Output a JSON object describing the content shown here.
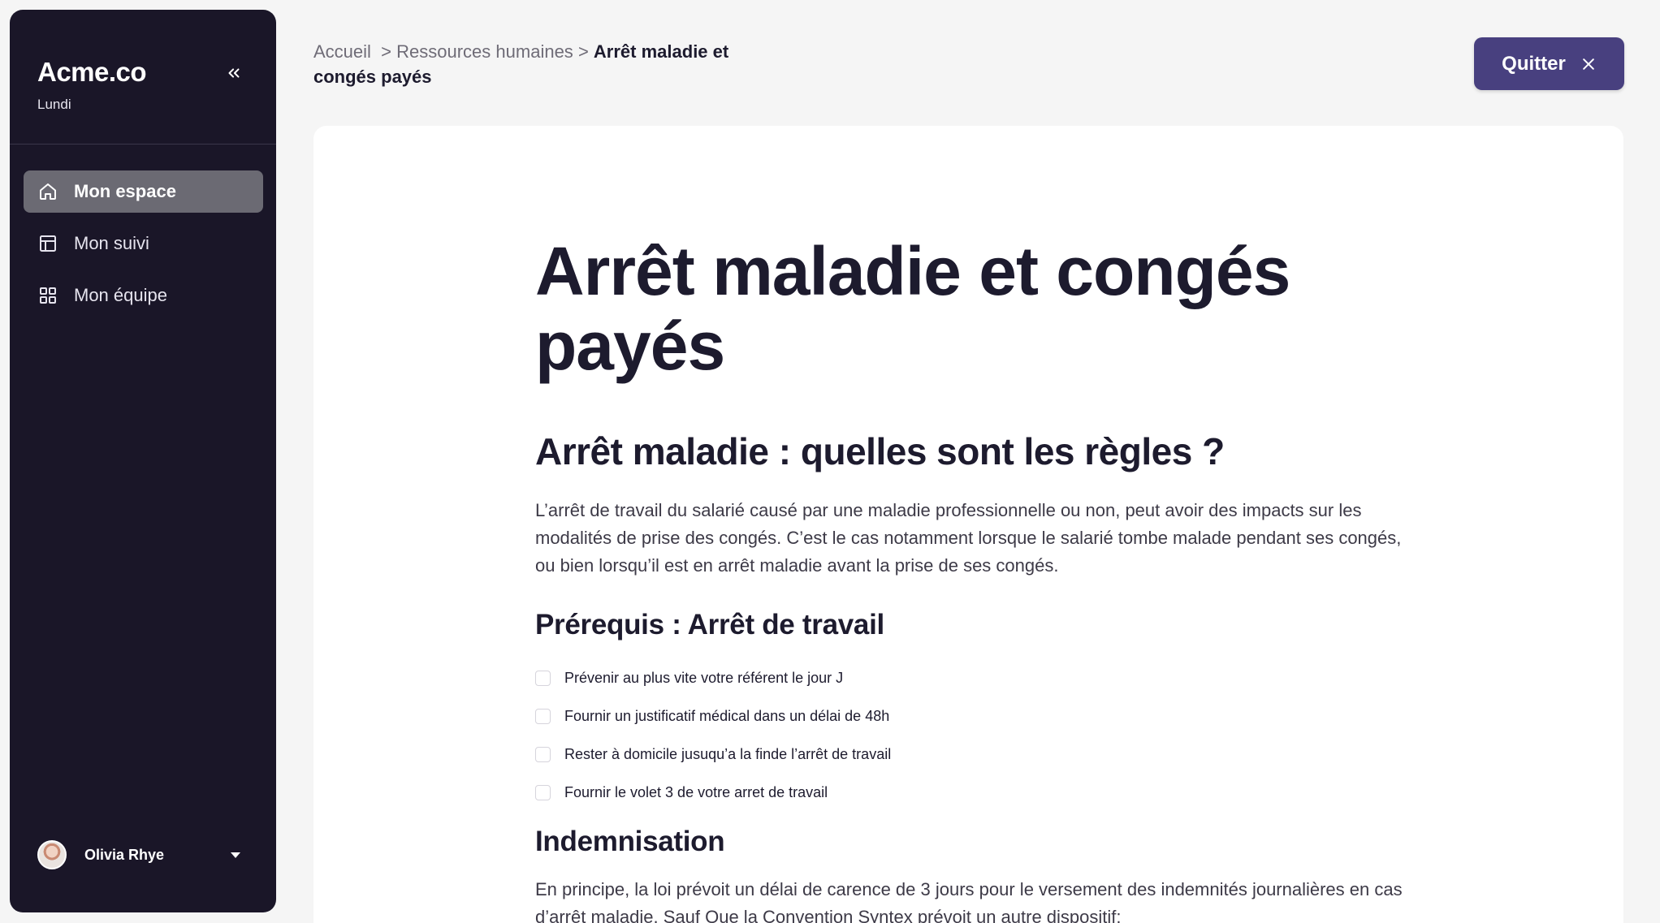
{
  "sidebar": {
    "brand": "Acme.co",
    "subtitle": "Lundi",
    "items": [
      {
        "label": "Mon espace",
        "icon": "home-icon",
        "active": true
      },
      {
        "label": "Mon suivi",
        "icon": "layout-icon",
        "active": false
      },
      {
        "label": "Mon équipe",
        "icon": "grid-icon",
        "active": false
      }
    ],
    "user": {
      "name": "Olivia Rhye"
    }
  },
  "header": {
    "breadcrumb": {
      "home": "Accueil",
      "sep1": ">",
      "section": "Ressources humaines",
      "sep2": ">",
      "current": "Arrêt maladie et congés payés"
    },
    "quit_label": "Quitter"
  },
  "article": {
    "title": "Arrêt maladie et congés payés",
    "section_title": "Arrêt maladie : quelles sont les règles ?",
    "intro": "L’arrêt de travail du salarié causé par une maladie professionnelle ou non, peut avoir des impacts sur les modalités de prise des congés. C’est le cas notamment lorsque le salarié tombe malade pendant ses congés, ou bien lorsqu’il est en arrêt maladie avant la prise de ses congés.",
    "prereq_title": "Prérequis : Arrêt de travail",
    "checklist": [
      "Prévenir au plus vite votre référent le jour J",
      "Fournir un justificatif médical dans un délai de 48h",
      "Rester à domicile jusuqu’a la finde l’arrêt de travail",
      "Fournir le volet 3 de votre arret de travail"
    ],
    "indemnisation_title": "Indemnisation",
    "indemnisation_text": "En principe, la loi prévoit un délai de carence de 3 jours  pour le versement des indemnités journalières en cas d’arrêt maladie. Sauf Que la Convention Syntex prévoit un autre dispositif:"
  },
  "colors": {
    "sidebar_bg": "#1a1628",
    "active_item_bg": "#6b6a73",
    "accent": "#48407f",
    "page_bg": "#f5f5f5"
  }
}
